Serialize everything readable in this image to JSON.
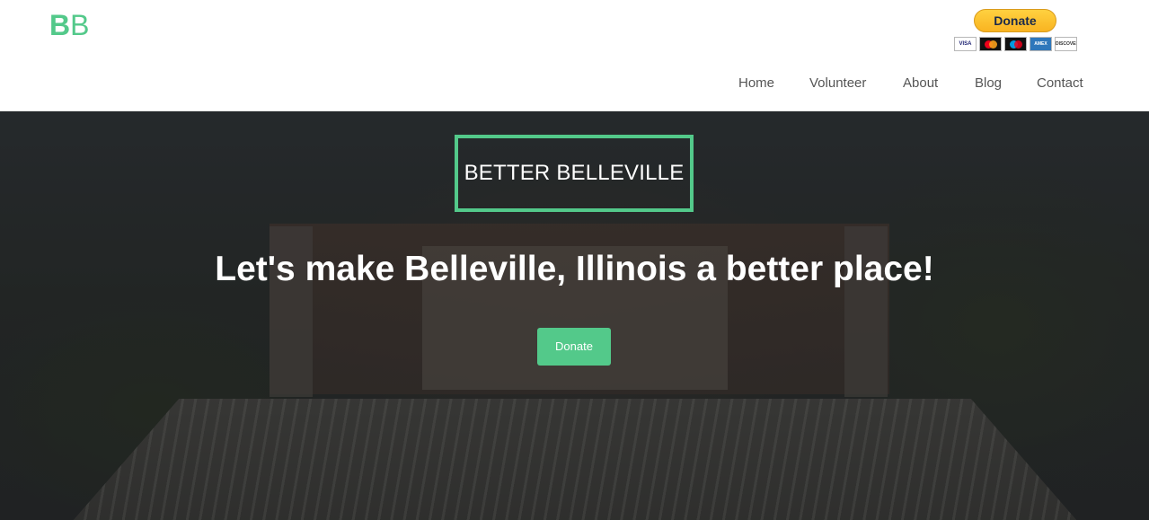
{
  "header": {
    "logo": {
      "first": "B",
      "second": "B"
    },
    "paypal": {
      "donate_label": "Donate",
      "cards": [
        {
          "name": "visa-card-icon",
          "label": "VISA"
        },
        {
          "name": "mastercard-icon",
          "label": ""
        },
        {
          "name": "maestro-card-icon",
          "label": ""
        },
        {
          "name": "amex-card-icon",
          "label": "AMERICAN EXPRESS"
        },
        {
          "name": "discover-card-icon",
          "label": "DISCOVER"
        }
      ]
    },
    "nav": {
      "items": [
        "Home",
        "Volunteer",
        "About",
        "Blog",
        "Contact"
      ]
    }
  },
  "hero": {
    "title": "BETTER BELLEVILLE",
    "headline": "Let's make Belleville, Illinois a better place!",
    "donate_label": "Donate"
  },
  "colors": {
    "accent": "#53c98a",
    "nav_text": "#555555",
    "paypal_yellow": "#ffc439"
  }
}
